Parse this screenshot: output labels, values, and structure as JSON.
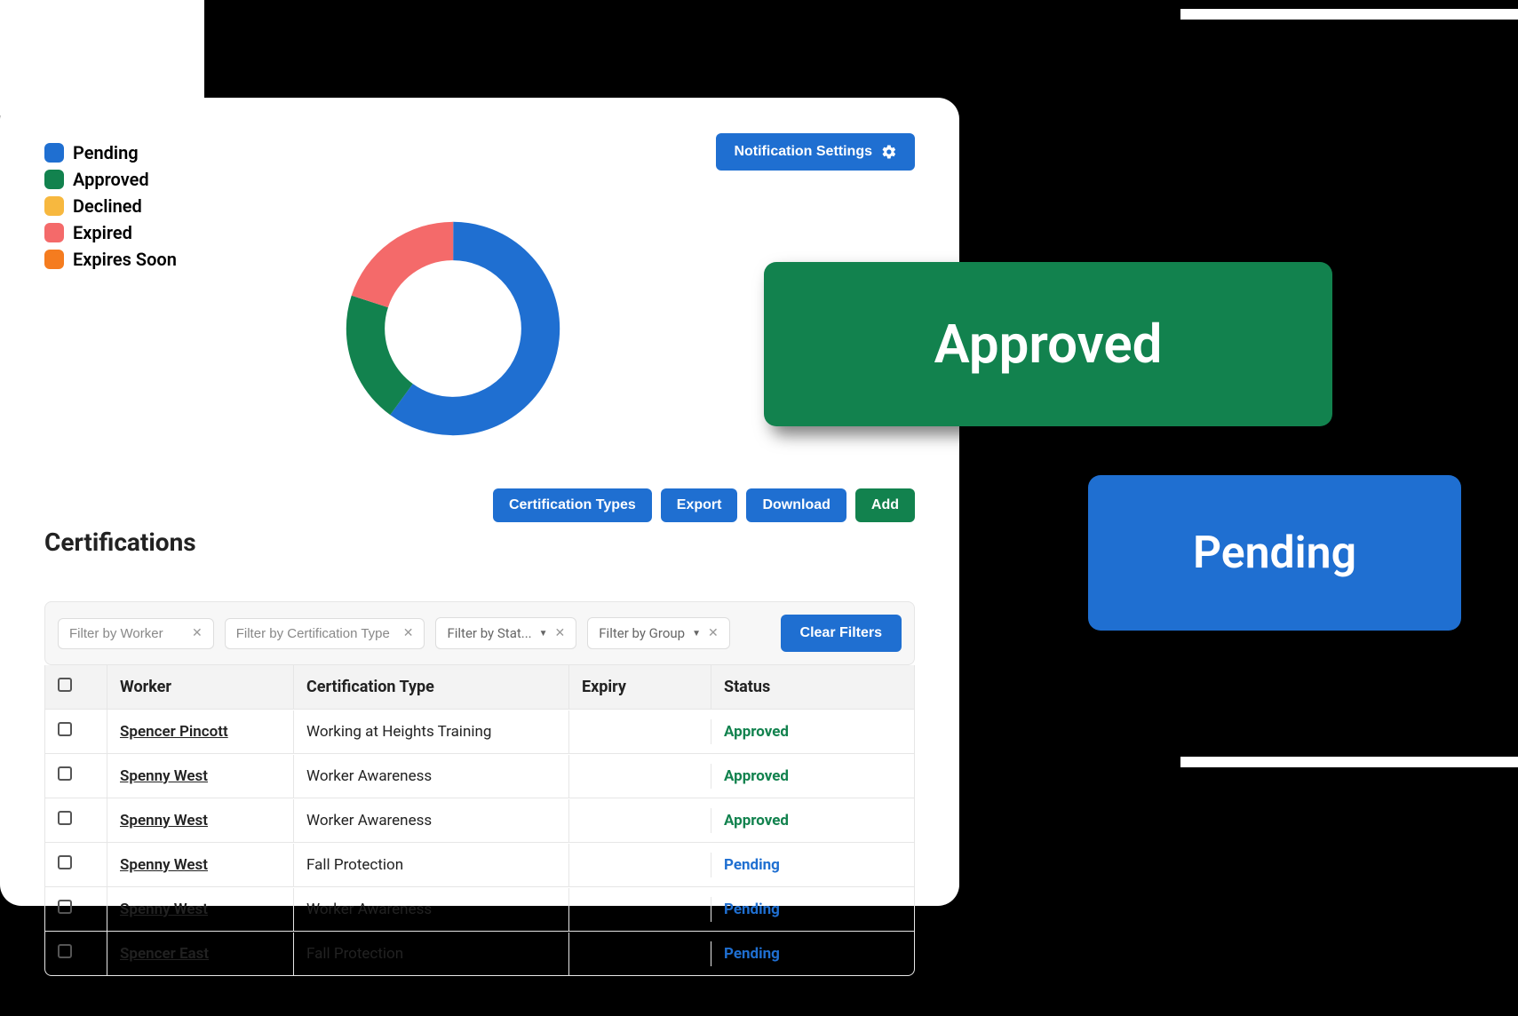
{
  "header": {
    "notification_button": "Notification Settings"
  },
  "legend": {
    "pending": "Pending",
    "approved": "Approved",
    "declined": "Declined",
    "expired": "Expired",
    "expires_soon": "Expires Soon"
  },
  "colors": {
    "pending": "#1f6fd1",
    "approved": "#12824e",
    "declined": "#f7b83f",
    "expired": "#f46a6a",
    "expires_soon": "#f57c1f"
  },
  "chart_data": {
    "type": "pie",
    "title": "",
    "categories": [
      "Pending",
      "Approved",
      "Expired"
    ],
    "values": [
      60,
      20,
      20
    ],
    "colors": [
      "#1f6fd1",
      "#12824e",
      "#f46a6a"
    ]
  },
  "section": {
    "title": "Certifications"
  },
  "actions": {
    "cert_types": "Certification Types",
    "export": "Export",
    "download": "Download",
    "add": "Add"
  },
  "filters": {
    "worker_placeholder": "Filter by Worker",
    "cert_type_placeholder": "Filter by Certification Type",
    "status_placeholder": "Filter by Stat...",
    "group_placeholder": "Filter by Group",
    "clear": "Clear Filters"
  },
  "table": {
    "headers": {
      "worker": "Worker",
      "cert_type": "Certification Type",
      "expiry": "Expiry",
      "status": "Status"
    },
    "rows": [
      {
        "worker": "Spencer Pincott",
        "cert_type": "Working at Heights Training",
        "expiry": "",
        "status": "Approved",
        "status_class": "approved"
      },
      {
        "worker": "Spenny West",
        "cert_type": "Worker Awareness",
        "expiry": "",
        "status": "Approved",
        "status_class": "approved"
      },
      {
        "worker": "Spenny West",
        "cert_type": "Worker Awareness",
        "expiry": "",
        "status": "Approved",
        "status_class": "approved"
      },
      {
        "worker": "Spenny West",
        "cert_type": "Fall Protection",
        "expiry": "",
        "status": "Pending",
        "status_class": "pending"
      },
      {
        "worker": "Spenny West",
        "cert_type": "Worker Awareness",
        "expiry": "",
        "status": "Pending",
        "status_class": "pending"
      },
      {
        "worker": "Spencer East",
        "cert_type": "Fall Protection",
        "expiry": "",
        "status": "Pending",
        "status_class": "pending"
      }
    ]
  },
  "badges": {
    "approved": "Approved",
    "pending": "Pending"
  }
}
